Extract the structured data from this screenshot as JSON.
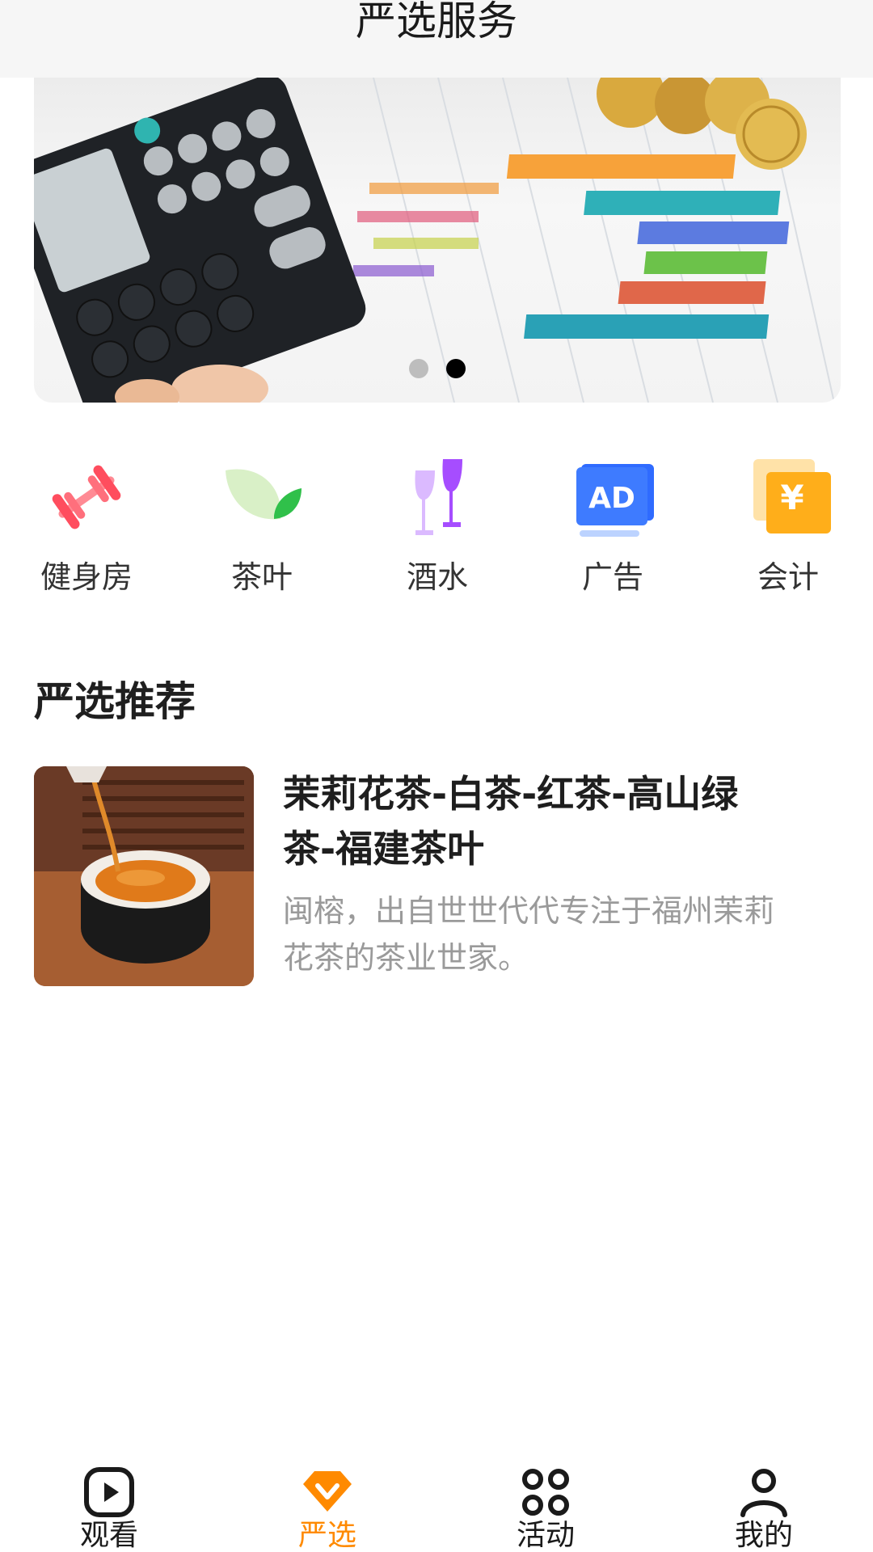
{
  "header": {
    "title": "严选服务"
  },
  "banner": {
    "page_count": 2,
    "active_index": 1
  },
  "categories": [
    {
      "label": "健身房",
      "icon": "dumbbell-icon",
      "color": "#ff5a6a"
    },
    {
      "label": "茶叶",
      "icon": "tea-leaf-icon",
      "color": "#34c24a"
    },
    {
      "label": "酒水",
      "icon": "wine-glass-icon",
      "color": "#a64dff"
    },
    {
      "label": "广告",
      "icon": "ad-icon",
      "color": "#2f6bff",
      "icon_text": "AD"
    },
    {
      "label": "会计",
      "icon": "yen-icon",
      "color": "#ffae1a",
      "icon_text": "¥"
    }
  ],
  "recommend": {
    "section_title": "严选推荐",
    "item": {
      "title": "茉莉花茶-白茶-红茶-高山绿茶-福建茶叶",
      "desc": "闽榕，出自世世代代专注于福州茉莉花茶的茶业世家。"
    }
  },
  "tabbar": {
    "active_color": "#ff8a00",
    "tabs": [
      {
        "label": "观看",
        "icon": "play-icon",
        "active": false
      },
      {
        "label": "严选",
        "icon": "select-icon",
        "active": true
      },
      {
        "label": "活动",
        "icon": "grid-icon",
        "active": false
      },
      {
        "label": "我的",
        "icon": "person-icon",
        "active": false
      }
    ]
  }
}
